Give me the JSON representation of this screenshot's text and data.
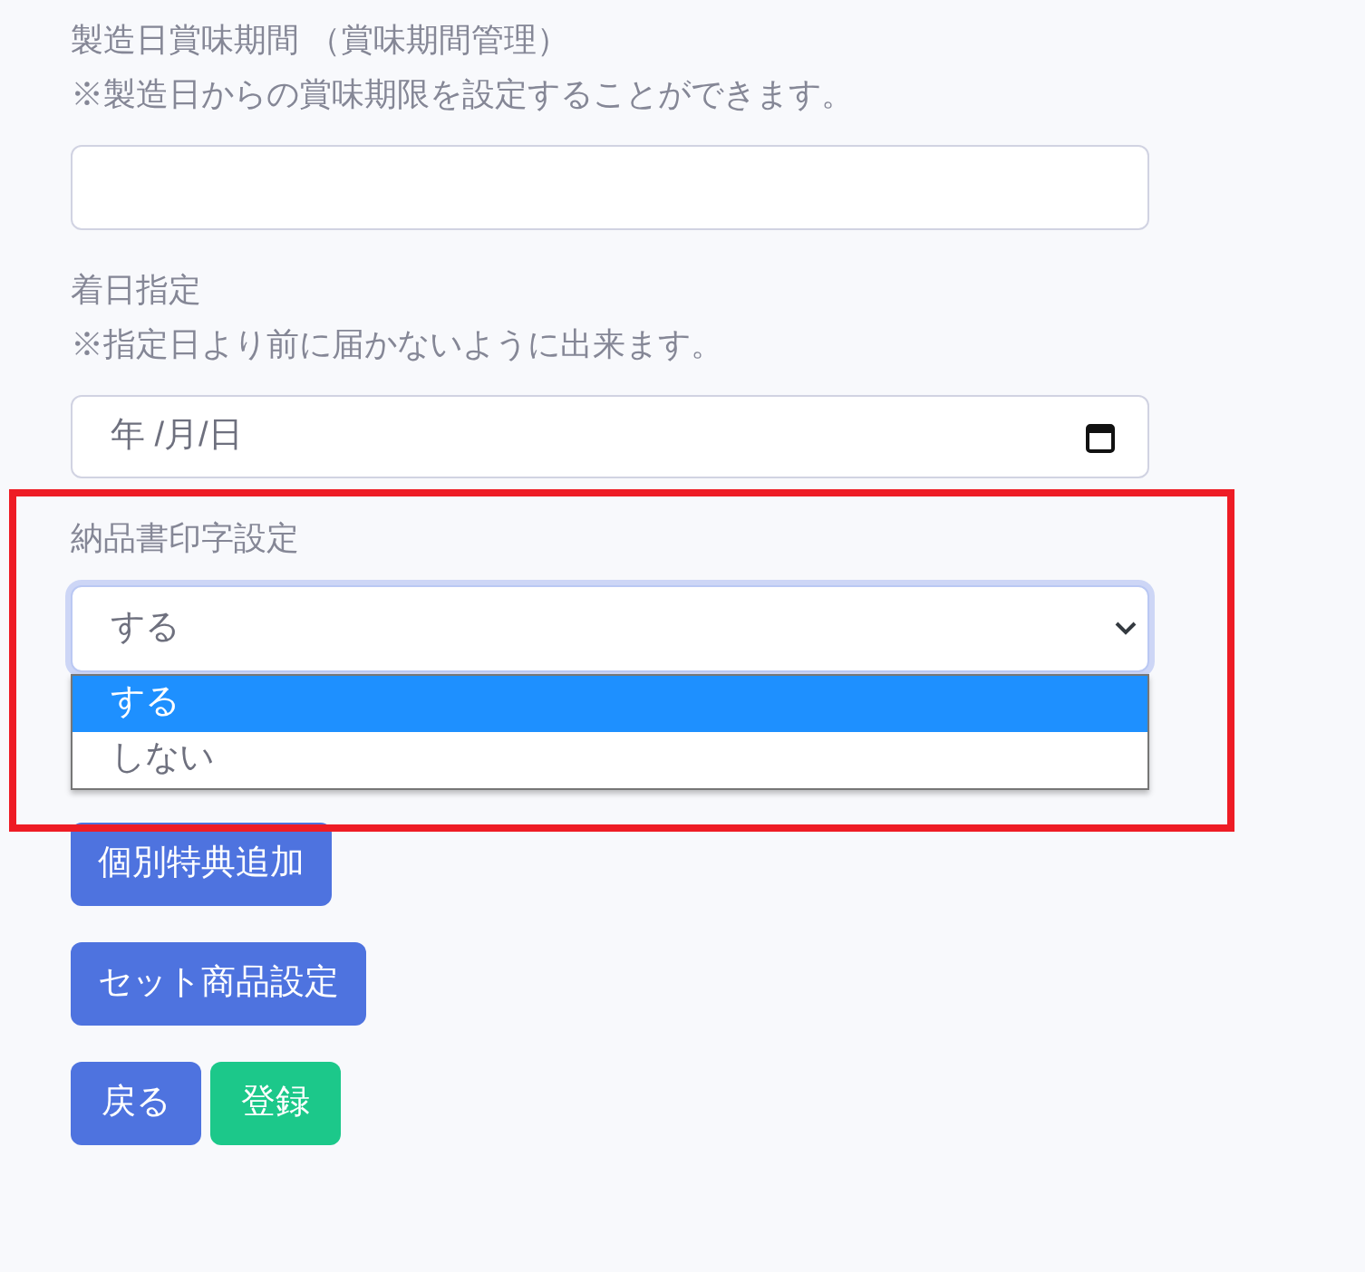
{
  "fields": [
    {
      "kind": "text",
      "label": "製造日賞味期間 （賞味期間管理）",
      "note": "※製造日からの賞味期限を設定することができます。"
    },
    {
      "kind": "date",
      "label": "着日指定",
      "note": "※指定日より前に届かないように出来ます。",
      "value": "年 /月/日"
    },
    {
      "kind": "select",
      "label": "納品書印字設定",
      "value": "する",
      "expanded": true,
      "options": [
        {
          "label": "する",
          "selected": true
        },
        {
          "label": "しない",
          "selected": false
        }
      ]
    }
  ],
  "buttons": [
    {
      "label": "個別特典追加",
      "kind": "primary"
    },
    {
      "label": "セット商品設定",
      "kind": "primary"
    }
  ],
  "footer_buttons": [
    {
      "label": "戻る",
      "kind": "primary"
    },
    {
      "label": "登録",
      "kind": "success"
    }
  ],
  "highlight": {
    "shown": true
  }
}
